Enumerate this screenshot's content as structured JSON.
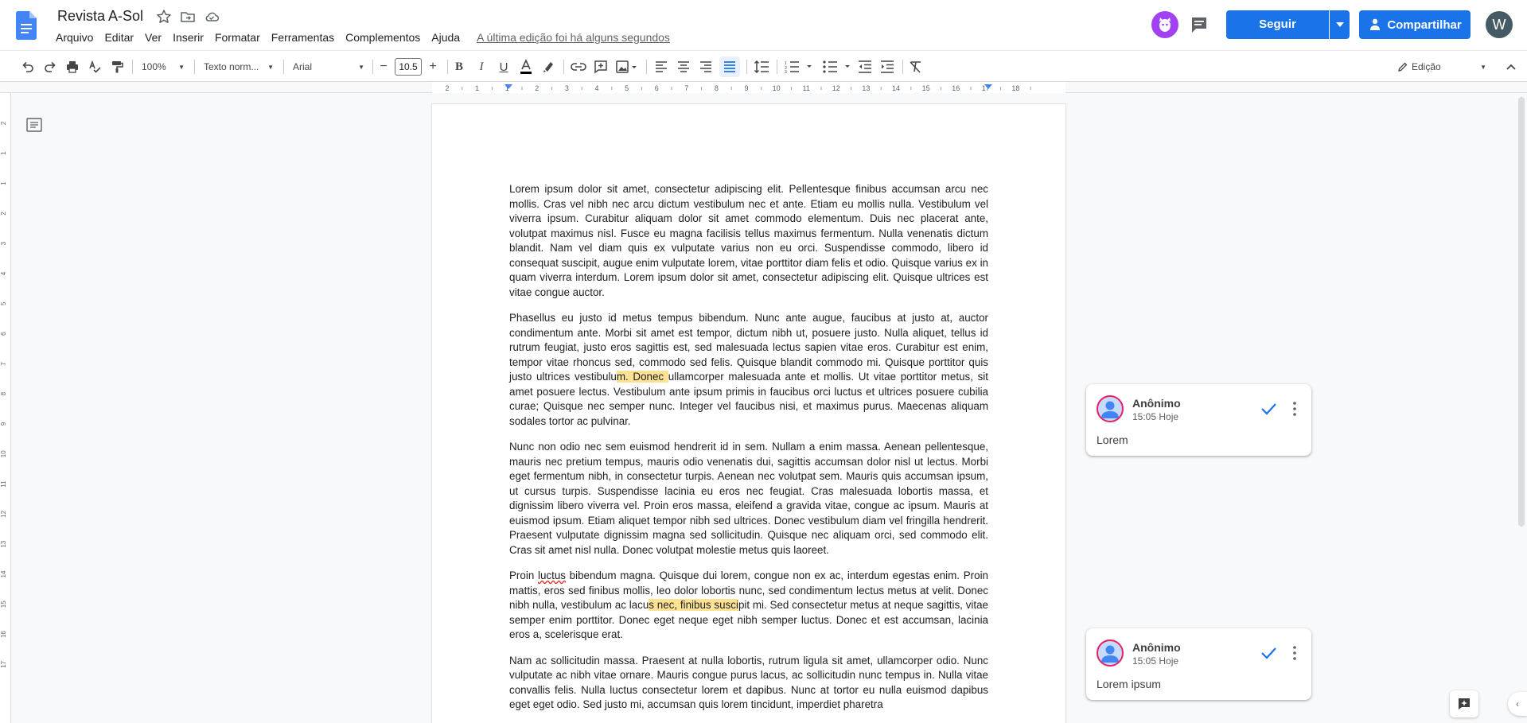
{
  "app": {
    "title": "Revista A-Sol",
    "last_edit": "A última edição foi há alguns segundos",
    "menu": [
      "Arquivo",
      "Editar",
      "Ver",
      "Inserir",
      "Formatar",
      "Ferramentas",
      "Complementos",
      "Ajuda"
    ]
  },
  "header": {
    "follow_label": "Seguir",
    "share_label": "Compartilhar",
    "user_initial": "W",
    "accent_color": "#1a73e8"
  },
  "toolbar": {
    "zoom": "100%",
    "style": "Texto norm...",
    "font": "Arial",
    "font_size": "10.5",
    "mode": "Edição"
  },
  "ruler": {
    "h_ticks": [
      "2",
      "1",
      "1",
      "2",
      "3",
      "4",
      "5",
      "6",
      "7",
      "8",
      "9",
      "10",
      "11",
      "12",
      "13",
      "14",
      "15",
      "16",
      "17",
      "18"
    ],
    "v_ticks": [
      "2",
      "1",
      "1",
      "2",
      "3",
      "4",
      "5",
      "6",
      "7",
      "8",
      "9",
      "10",
      "11",
      "12",
      "13",
      "14",
      "15",
      "16",
      "17"
    ]
  },
  "document": {
    "paragraphs": [
      [
        {
          "t": "Lorem ipsum dolor sit amet, consectetur adipiscing elit. Pellentesque finibus accumsan arcu nec mollis. Cras vel nibh nec arcu dictum vestibulum nec et ante. Etiam eu mollis nulla. Vestibulum vel viverra ipsum. Curabitur aliquam dolor sit amet commodo elementum. Duis nec placerat ante, volutpat maximus nisl. Fusce eu magna facilisis tellus maximus fermentum. Nulla venenatis dictum blandit. Nam vel diam quis ex vulputate varius non eu orci. Suspendisse commodo, libero id consequat suscipit, augue enim vulputate lorem, vitae porttitor diam felis et odio. Quisque varius ex in quam viverra interdum. Lorem ipsum dolor sit amet, consectetur adipiscing elit. Quisque ultrices est vitae congue auctor."
        }
      ],
      [
        {
          "t": "Phasellus eu justo id metus tempus bibendum. Nunc ante augue, faucibus at justo at, auctor condimentum ante. Morbi sit amet est tempor, dictum nibh ut, posuere justo. Nulla aliquet, tellus id rutrum feugiat, justo eros sagittis est, sed malesuada lectus sapien vitae eros. Curabitur est enim, tempor vitae rhoncus sed, commodo sed felis. Quisque blandit commodo mi. Quisque porttitor quis justo ultrices vestibulu"
        },
        {
          "t": "m. Donec ",
          "hl": true
        },
        {
          "t": "ullamcorper malesuada ante et mollis. Ut vitae porttitor metus, sit amet posuere lectus. Vestibulum ante ipsum primis in faucibus orci luctus et ultrices posuere cubilia curae; Quisque nec semper nunc. Integer vel faucibus nisi, et maximus purus. Maecenas aliquam sodales tortor ac pulvinar."
        }
      ],
      [
        {
          "t": "Nunc non odio nec sem euismod hendrerit id in sem. Nullam a enim massa. Aenean pellentesque, mauris nec pretium tempus, mauris odio venenatis dui, sagittis accumsan dolor nisl ut lectus. Morbi eget fermentum nibh, in consectetur turpis. Aenean nec volutpat sem. Mauris quis accumsan ipsum, ut cursus turpis. Suspendisse lacinia eu eros nec feugiat. Cras malesuada lobortis massa, et dignissim libero viverra vel. Proin eros massa, eleifend a gravida vitae, congue ac ipsum. Mauris at euismod ipsum. Etiam aliquet tempor nibh sed ultrices. Donec vestibulum diam vel fringilla hendrerit. Praesent vulputate dignissim magna sed sollicitudin. Quisque nec aliquam orci, sed commodo elit. Cras sit amet nisl nulla. Donec volutpat molestie metus quis laoreet."
        }
      ],
      [
        {
          "t": "Proin "
        },
        {
          "t": "luctus",
          "spell": true
        },
        {
          "t": " bibendum magna. Quisque dui lorem, congue non ex ac, interdum egestas enim. Proin mattis, eros sed finibus mollis, leo dolor lobortis nunc, sed condimentum lectus metus at velit. Donec nibh nulla, vestibulum ac lacu"
        },
        {
          "t": "s nec, finibus susci",
          "hl": true
        },
        {
          "t": "pit mi. Sed consectetur metus at neque sagittis, vitae semper enim porttitor. Donec eget neque eget nibh semper luctus. Donec et est accumsan, lacinia eros a, scelerisque erat."
        }
      ],
      [
        {
          "t": "Nam ac sollicitudin massa. Praesent at nulla lobortis, rutrum ligula sit amet, ullamcorper odio. Nunc vulputate ac nibh vitae ornare. Mauris congue purus lacus, ac sollicitudin nunc tempus in. Nulla vitae convallis felis. Nulla luctus consectetur lorem et dapibus. Nunc at tortor eu nulla euismod dapibus eget eget odio. Sed justo mi, accumsan quis lorem tincidunt, imperdiet pharetra"
        }
      ]
    ]
  },
  "comments": [
    {
      "author": "Anônimo",
      "time": "15:05 Hoje",
      "text": "Lorem"
    },
    {
      "author": "Anônimo",
      "time": "15:05 Hoje",
      "text": "Lorem ipsum"
    }
  ]
}
